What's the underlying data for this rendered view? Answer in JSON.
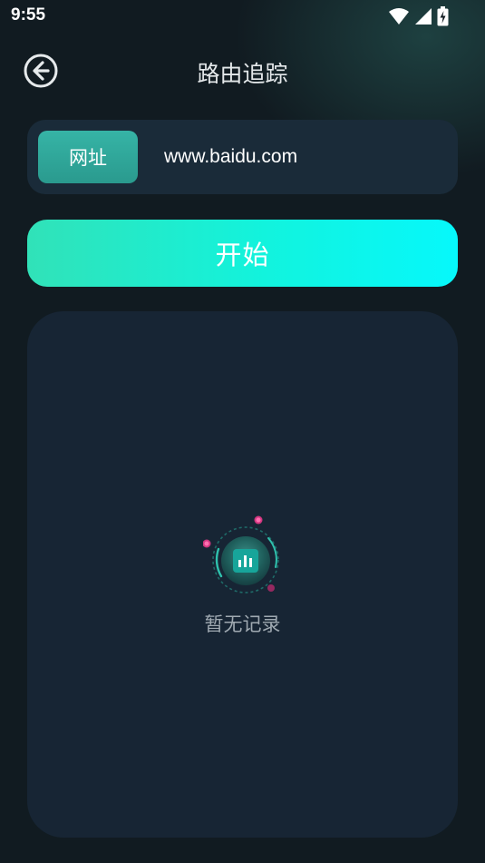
{
  "status_bar": {
    "time": "9:55",
    "icons": [
      "wifi-icon",
      "signal-icon",
      "battery-charging-icon"
    ]
  },
  "nav": {
    "back_icon": "arrow-left-circle-icon",
    "title": "路由追踪"
  },
  "url_form": {
    "label": "网址",
    "value": "www.baidu.com",
    "placeholder": ""
  },
  "start_button": {
    "label": "开始"
  },
  "records": {
    "empty_icon": "bar-chart-icon",
    "empty_text": "暂无记录"
  },
  "colors": {
    "background": "#111b21",
    "card": "#1a2b39",
    "panel": "#172534",
    "label_teal": "#34b0a3",
    "button_gradient_start": "#31e2b8",
    "button_gradient_end": "#06f8fb",
    "accent_pink": "#e83a8a"
  }
}
